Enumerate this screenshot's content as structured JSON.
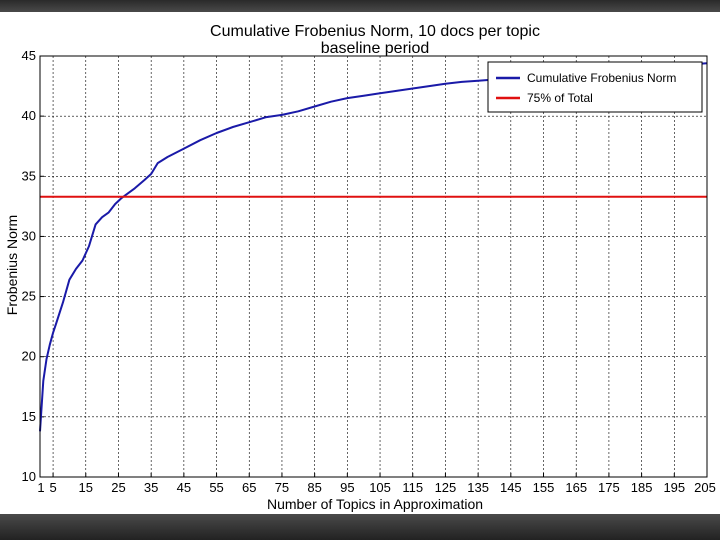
{
  "chart_data": {
    "type": "line",
    "title": "Cumulative Frobenius Norm, 10 docs per topic",
    "subtitle": "baseline period",
    "xlabel": "Number of Topics in Approximation",
    "ylabel": "Frobenius Norm",
    "xlim": [
      1,
      205
    ],
    "ylim": [
      10,
      45
    ],
    "xticks": [
      1,
      5,
      15,
      25,
      35,
      45,
      55,
      65,
      75,
      85,
      95,
      105,
      115,
      125,
      135,
      145,
      155,
      165,
      175,
      185,
      195,
      205
    ],
    "yticks": [
      10,
      15,
      20,
      25,
      30,
      35,
      40,
      45
    ],
    "grid": true,
    "legend_position": "top-right",
    "series": [
      {
        "name": "Cumulative Frobenius Norm",
        "color": "#1a1aa8",
        "x": [
          1,
          2,
          3,
          4,
          5,
          6,
          8,
          10,
          12,
          14,
          16,
          18,
          20,
          22,
          24,
          26,
          28,
          30,
          33,
          35,
          37,
          40,
          45,
          50,
          55,
          60,
          65,
          70,
          75,
          80,
          85,
          90,
          95,
          100,
          105,
          110,
          115,
          120,
          125,
          130,
          135,
          140,
          145,
          150,
          160,
          170,
          180,
          190,
          200,
          205
        ],
        "y": [
          13.8,
          18.0,
          19.8,
          21.0,
          22.0,
          22.8,
          24.5,
          26.4,
          27.3,
          28.0,
          29.2,
          31.0,
          31.6,
          32.0,
          32.7,
          33.2,
          33.6,
          34.0,
          34.7,
          35.2,
          36.1,
          36.6,
          37.3,
          38.0,
          38.6,
          39.1,
          39.5,
          39.9,
          40.1,
          40.4,
          40.8,
          41.2,
          41.5,
          41.7,
          41.9,
          42.1,
          42.3,
          42.5,
          42.7,
          42.85,
          42.95,
          43.05,
          43.15,
          43.3,
          43.5,
          43.7,
          43.9,
          44.1,
          44.3,
          44.4
        ]
      },
      {
        "name": "75% of Total",
        "color": "#e01010",
        "x": [
          1,
          205
        ],
        "y": [
          33.3,
          33.3
        ]
      }
    ]
  }
}
